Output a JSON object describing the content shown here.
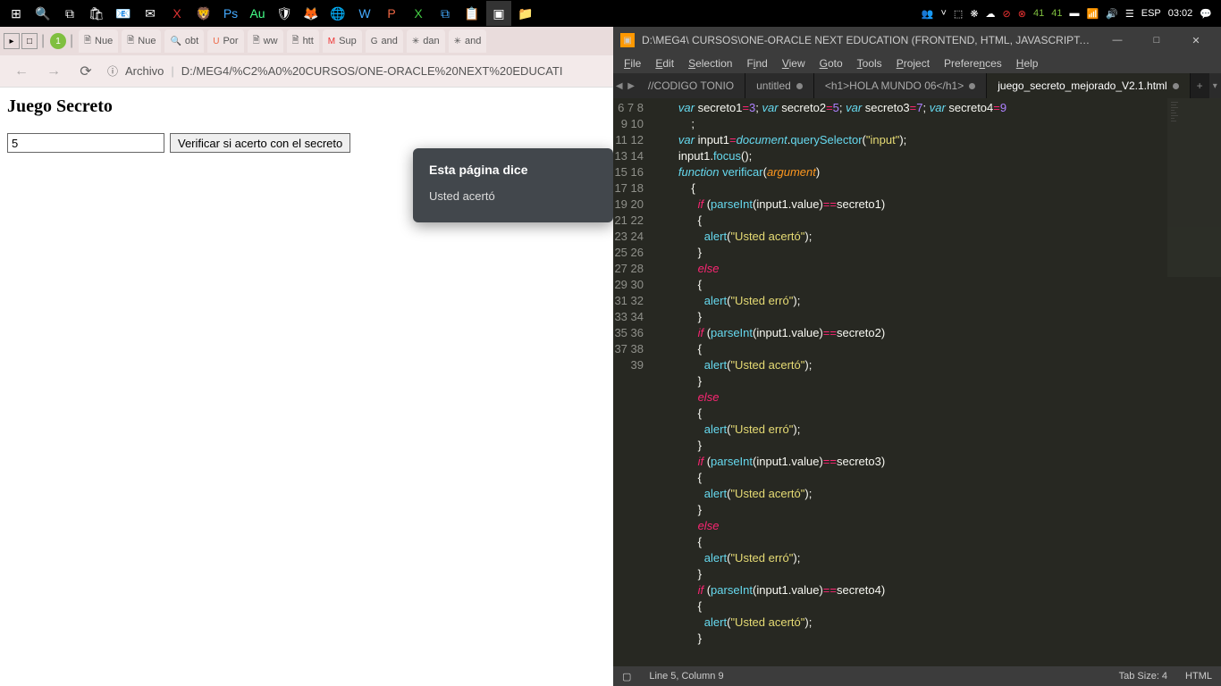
{
  "taskbar": {
    "right": {
      "n1": "41",
      "n2": "41",
      "lang": "ESP",
      "time": "03:02"
    }
  },
  "browser": {
    "tabs": [
      "Nue",
      "Nue",
      "obt",
      "Por",
      "ww",
      "htt",
      "Sup",
      "and",
      "dan",
      "and"
    ],
    "addr_label": "Archivo",
    "addr_path": "D:/MEG4/%C2%A0%20CURSOS/ONE-ORACLE%20NEXT%20EDUCATI"
  },
  "page": {
    "title": "Juego Secreto",
    "input_value": "5",
    "button": "Verificar si acerto con el secreto"
  },
  "alert": {
    "title": "Esta página dice",
    "msg": "Usted acertó"
  },
  "editor": {
    "title": "D:\\MEG4\\  CURSOS\\ONE-ORACLE NEXT EDUCATION (FRONTEND, HTML, JAVASCRIPT, CSS, JA…",
    "menus": [
      "File",
      "Edit",
      "Selection",
      "Find",
      "View",
      "Goto",
      "Tools",
      "Project",
      "Preferences",
      "Help"
    ],
    "tabs": [
      {
        "label": "//CODIGO TONIO",
        "active": false,
        "dirty": false
      },
      {
        "label": "untitled",
        "active": false,
        "dirty": true
      },
      {
        "label": "<h1>HOLA MUNDO 06</h1>",
        "active": false,
        "dirty": true
      },
      {
        "label": "juego_secreto_mejorado_V2.1.html",
        "active": true,
        "dirty": true
      }
    ],
    "line_start": 6,
    "line_end": 39,
    "status": {
      "pos": "Line 5, Column 9",
      "tab": "Tab Size: 4",
      "syntax": "HTML"
    }
  },
  "code": {
    "l6a": "var",
    "l6b": "secreto1",
    "l6c": "3",
    "l6d": "var",
    "l6e": "secreto2",
    "l6f": "5",
    "l6g": "var",
    "l6h": "secreto3",
    "l6i": "7",
    "l6j": "var",
    "l6k": "secreto4",
    "l6l": "9",
    "l7a": "var",
    "l7b": "input1",
    "l7c": "document",
    "l7d": "querySelector",
    "l7e": "\"input\"",
    "l8a": "input1",
    "l8b": "focus",
    "l9a": "function",
    "l9b": "verificar",
    "l9c": "argument",
    "if": "if",
    "else": "else",
    "alert": "alert",
    "parseInt": "parseInt",
    "input1": "input1",
    "value": "value",
    "sec1": "secreto1",
    "sec2": "secreto2",
    "sec3": "secreto3",
    "sec4": "secreto4",
    "acerto": "\"Usted acertó\"",
    "erro": "\"Usted erró\""
  }
}
